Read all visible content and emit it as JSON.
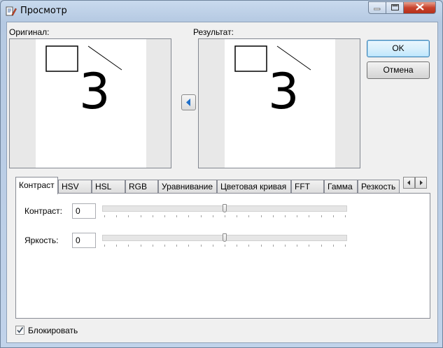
{
  "window": {
    "title": "Просмотр"
  },
  "preview": {
    "original_label": "Оригинал:",
    "result_label": "Результат:",
    "digit": "3"
  },
  "buttons": {
    "ok": "OK",
    "cancel": "Отмена"
  },
  "tabs": [
    {
      "label": "Контраст",
      "active": true
    },
    {
      "label": "HSV"
    },
    {
      "label": "HSL"
    },
    {
      "label": "RGB"
    },
    {
      "label": "Уравнивание"
    },
    {
      "label": "Цветовая кривая"
    },
    {
      "label": "FFT"
    },
    {
      "label": "Гамма"
    },
    {
      "label": "Резкость"
    }
  ],
  "contrast": {
    "label": "Контраст:",
    "value": "0",
    "slider_value": 0,
    "slider_range": [
      -100,
      100
    ]
  },
  "brightness": {
    "label": "Яркость:",
    "value": "0",
    "slider_value": 0,
    "slider_range": [
      -100,
      100
    ]
  },
  "lock": {
    "label": "Блокировать",
    "checked": true
  },
  "icons": [
    "app-icon",
    "minimize-icon",
    "maximize-icon",
    "close-icon",
    "arrow-left-icon",
    "chevron-left-icon",
    "chevron-right-icon",
    "checkmark-icon"
  ]
}
